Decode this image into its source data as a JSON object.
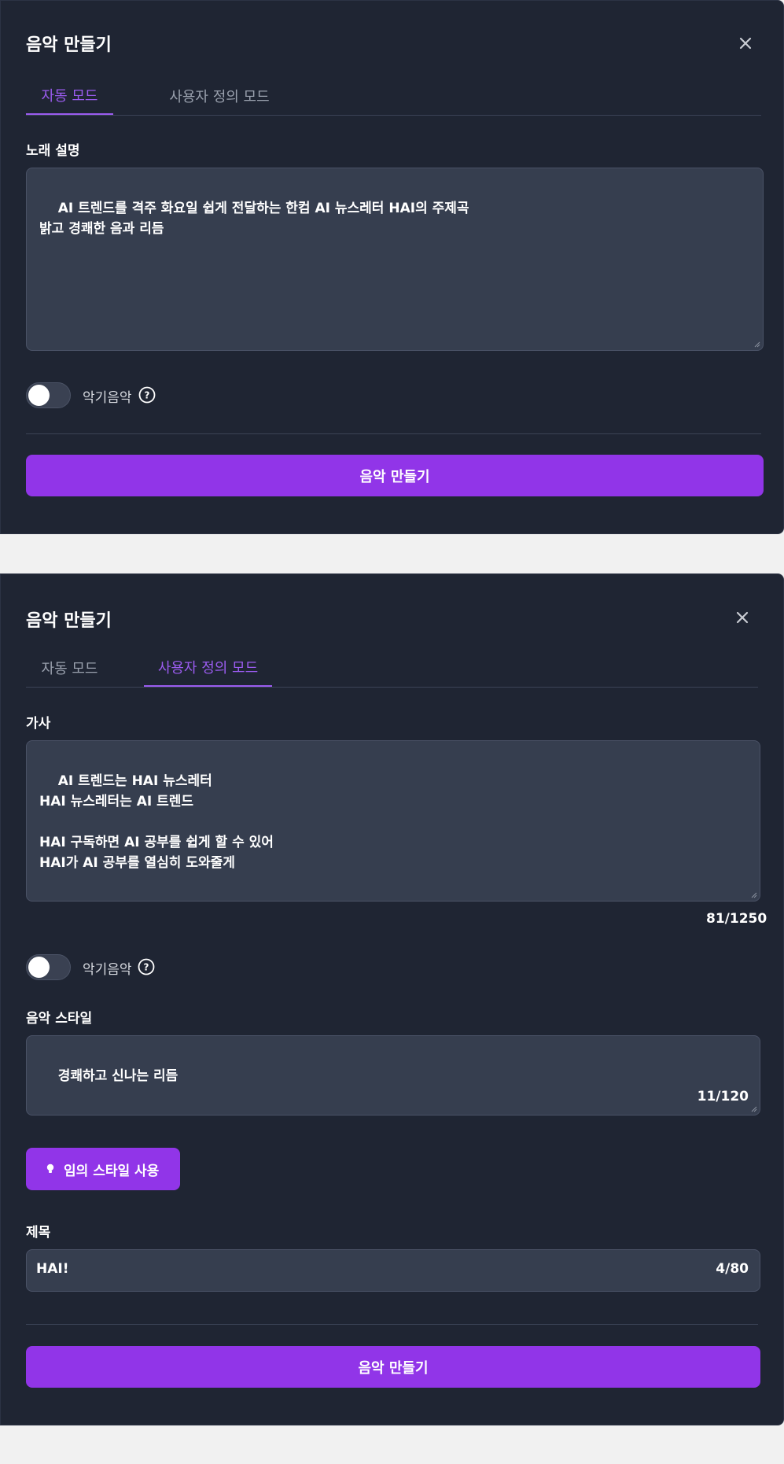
{
  "colors": {
    "panel_bg": "#1f2533",
    "field_bg": "#363e4f",
    "accent": "#9135e8",
    "tab_active": "#9b5cf0"
  },
  "auto_panel": {
    "title": "음악 만들기",
    "close_icon": "close-icon",
    "tabs": [
      {
        "label": "자동 모드",
        "active": true
      },
      {
        "label": "사용자 정의 모드",
        "active": false
      }
    ],
    "description_label": "노래 설명",
    "description_value": "AI 트렌드를 격주 화요일 쉽게 전달하는 한컴 AI 뉴스레터 HAI의 주제곡\n밝고 경쾌한 음과 리듬",
    "instrumental_label": "악기음악",
    "instrumental_on": false,
    "help_icon": "question-circle-icon",
    "submit_label": "음악 만들기"
  },
  "custom_panel": {
    "title": "음악 만들기",
    "close_icon": "close-icon",
    "tabs": [
      {
        "label": "자동 모드",
        "active": false
      },
      {
        "label": "사용자 정의 모드",
        "active": true
      }
    ],
    "lyrics_label": "가사",
    "lyrics_value": "AI 트렌드는 HAI 뉴스레터\nHAI 뉴스레터는 AI 트렌드\n\nHAI 구독하면 AI 공부를 쉽게 할 수 있어\nHAI가 AI 공부를 열심히 도와줄게",
    "lyrics_counter": "81/1250",
    "instrumental_label": "악기음악",
    "instrumental_on": false,
    "help_icon": "question-circle-icon",
    "style_label": "음악 스타일",
    "style_value": "경쾌하고 신나는 리듬",
    "style_counter": "11/120",
    "random_style_label": "임의 스타일 사용",
    "random_style_icon": "lightbulb-icon",
    "title_label": "제목",
    "title_value": "HAI!",
    "title_counter": "4/80",
    "submit_label": "음악 만들기"
  }
}
